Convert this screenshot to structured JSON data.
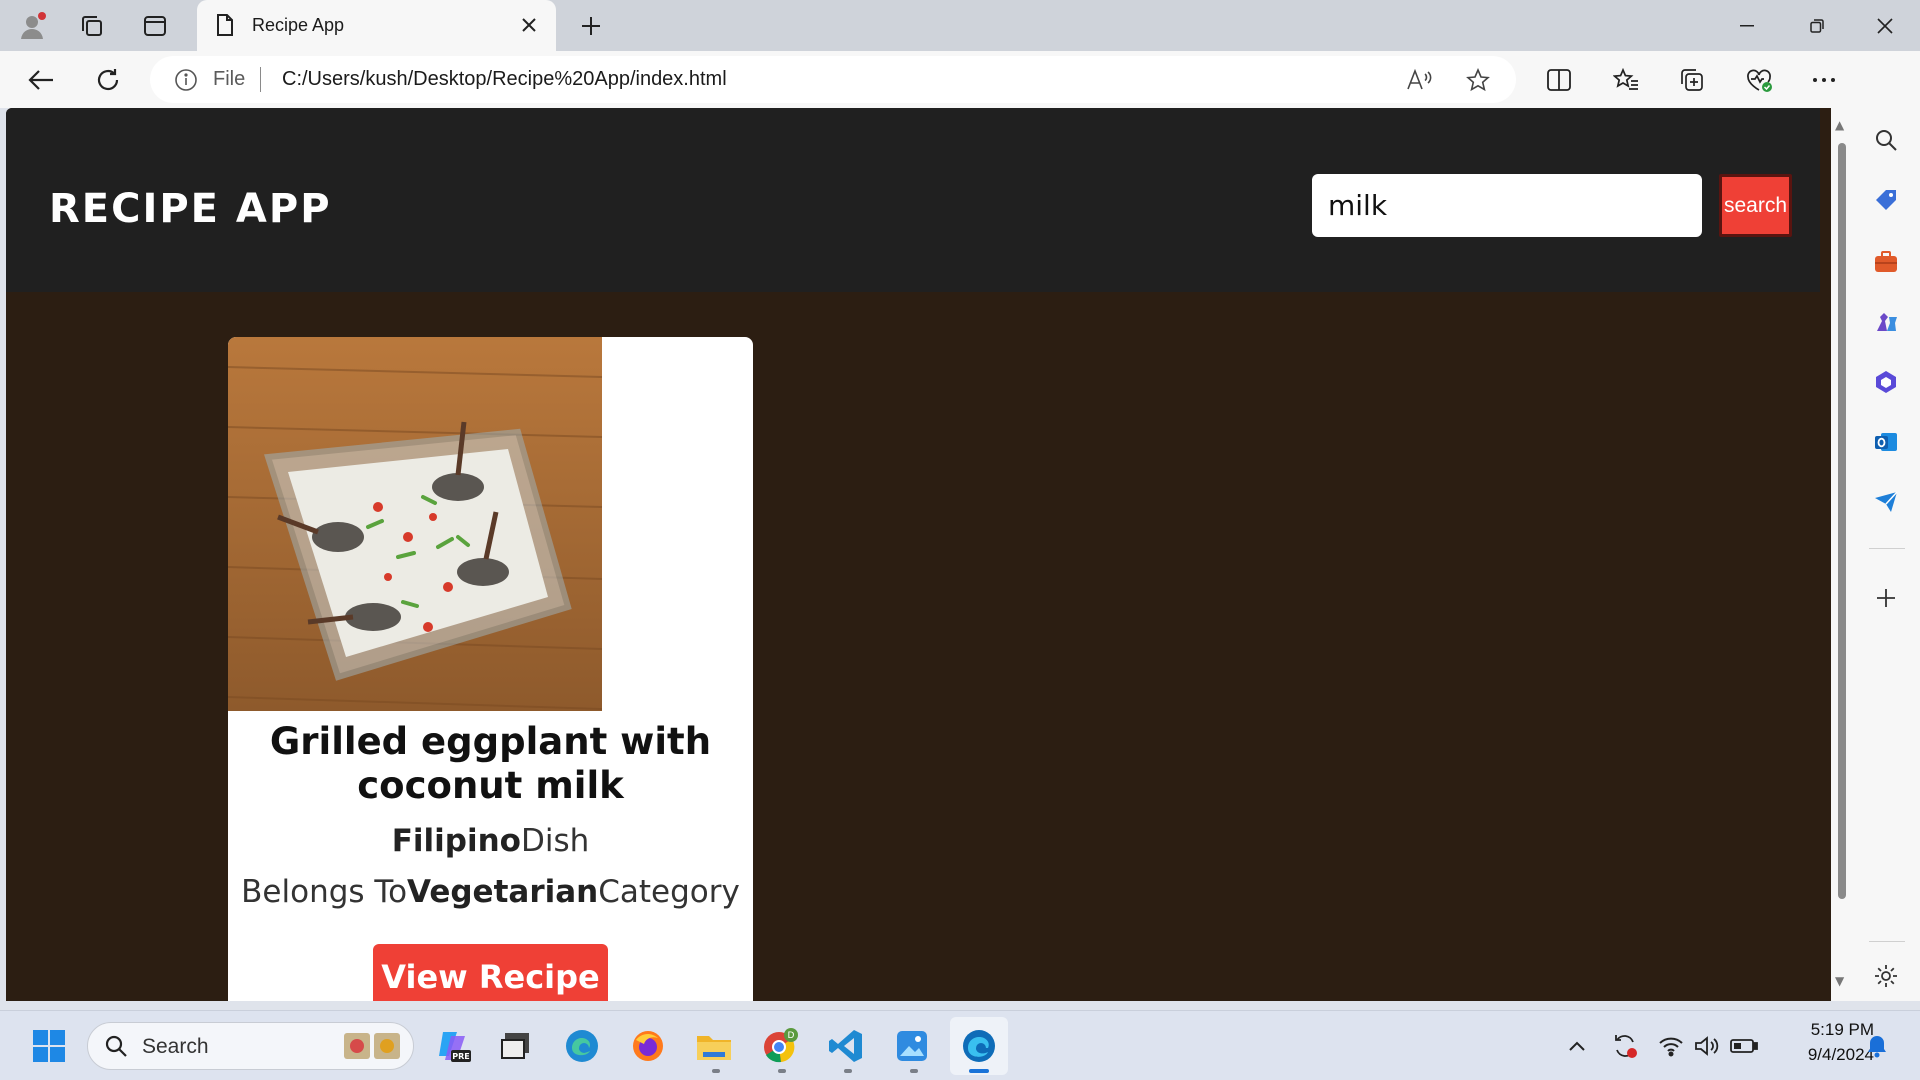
{
  "browser": {
    "tab_title": "Recipe App",
    "address_prefix": "File",
    "url": "C:/Users/kush/Desktop/Recipe%20App/index.html"
  },
  "page": {
    "logo": "RECIPE APP",
    "search_value": "milk",
    "search_button": "search",
    "recipe": {
      "name": "Grilled eggplant with coconut milk",
      "area": "Filipino",
      "area_suffix": "Dish",
      "category_prefix": "Belongs To",
      "category": "Vegetarian",
      "category_suffix": "Category",
      "button": "View Recipe"
    }
  },
  "taskbar": {
    "search_label": "Search",
    "time": "5:19 PM",
    "date": "9/4/2024"
  },
  "colors": {
    "accent_red": "#ef4036",
    "header_bg": "#202020",
    "page_bg": "#2c1e12"
  }
}
